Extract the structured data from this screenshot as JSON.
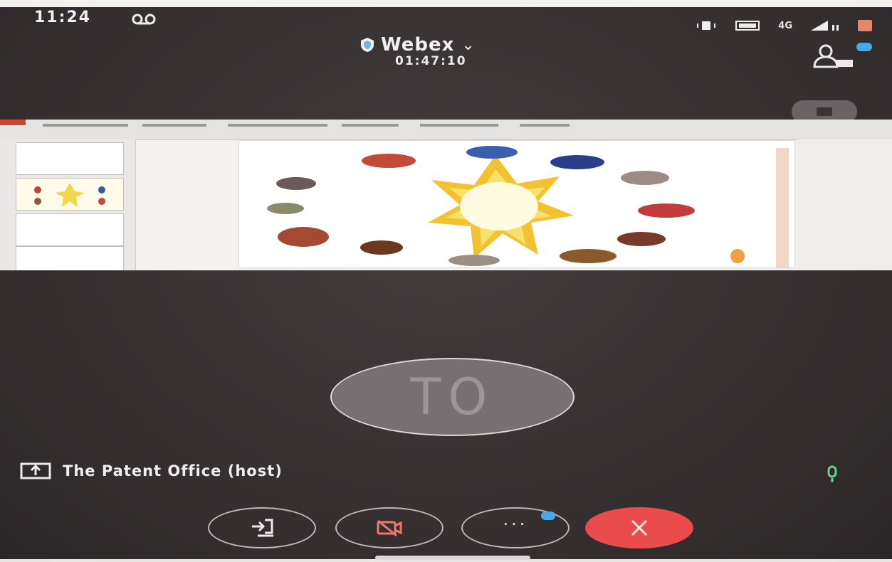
{
  "status_bar": {
    "time": "11:24",
    "network_label": "4G"
  },
  "header": {
    "meeting_name": "Webex",
    "chevron": "⌄",
    "elapsed": "01:47:10",
    "icons": [
      "shield-icon",
      "participants-icon"
    ]
  },
  "shared_content": {
    "description_icon": "presentation-slide"
  },
  "avatar": {
    "initials": "TO"
  },
  "presenter": {
    "label": "The Patent Office (host)"
  },
  "controls": {
    "items": [
      "share-button",
      "video-off-button",
      "more-options-button",
      "end-call-button"
    ],
    "more_label": "···"
  },
  "colors": {
    "background": "#3b3536",
    "end_call": "#ea4b4b",
    "badge": "#4aa8e8",
    "speaker_active": "#6dd08a"
  }
}
